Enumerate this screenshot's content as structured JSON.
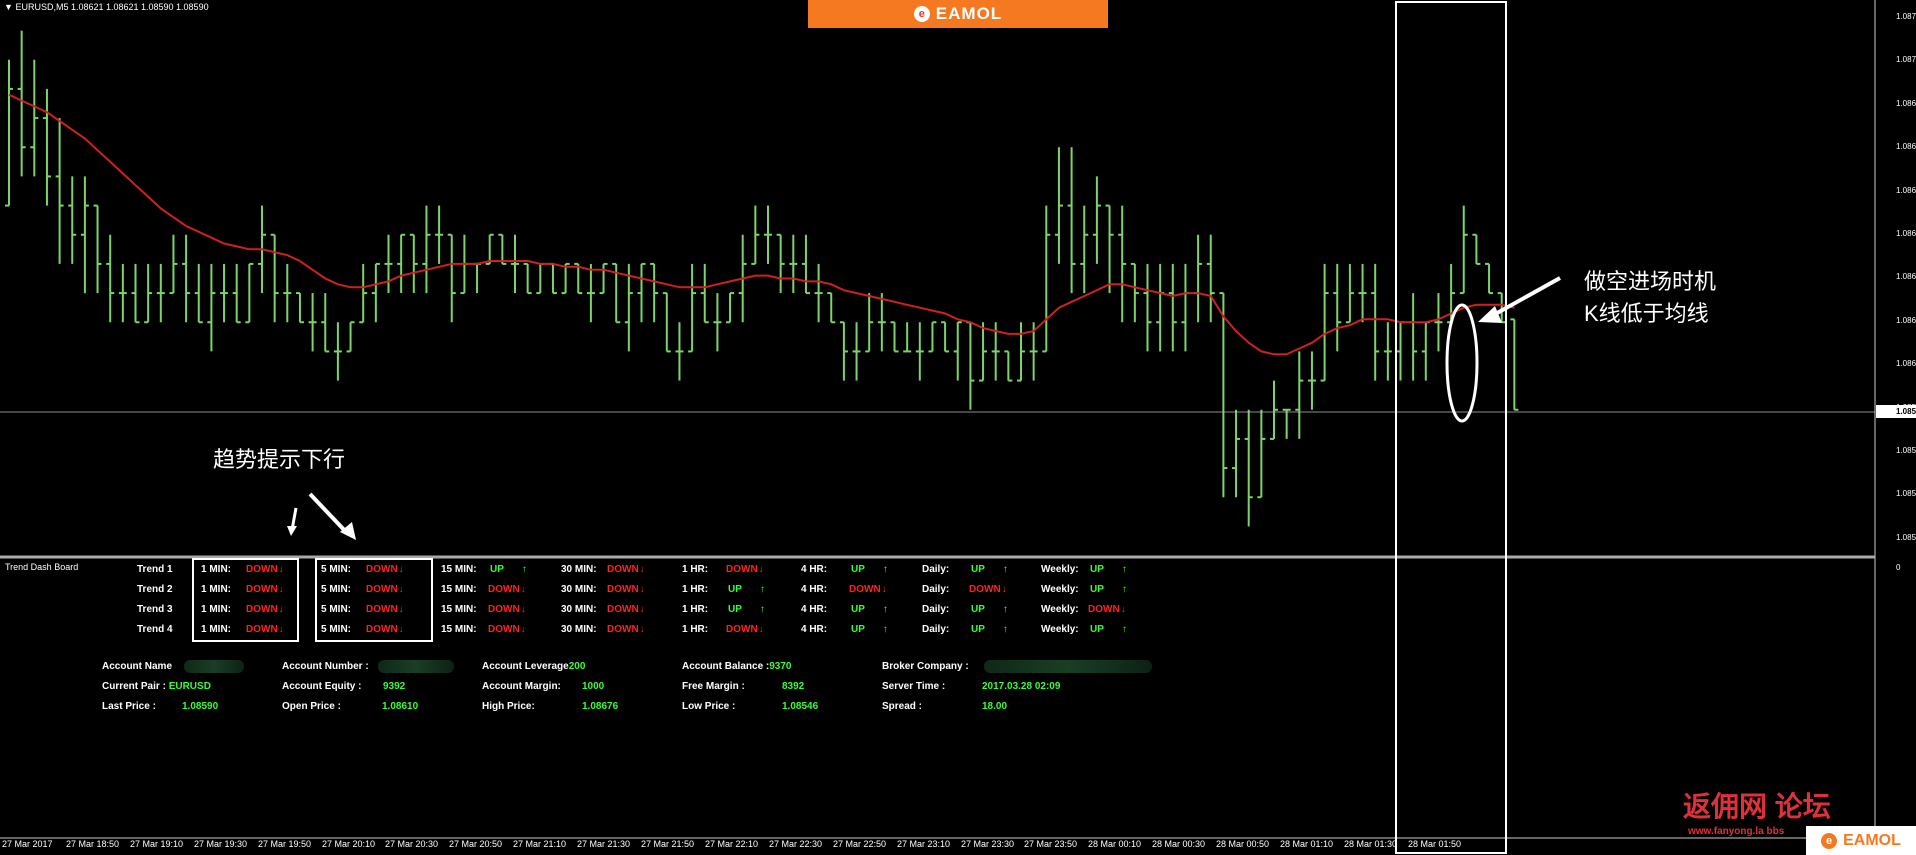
{
  "header": {
    "symbol_info": "EURUSD,M5  1.08621 1.08621 1.08590 1.08590"
  },
  "logo": {
    "text": "EAMOL"
  },
  "annotations": {
    "right_line1": "做空进场时机",
    "right_line2": "K线低于均线",
    "left": "趋势提示下行"
  },
  "colors": {
    "bar": "#7cd46a",
    "ma": "#d02020",
    "up": "#33ff33",
    "down": "#ff2020",
    "logo_bg": "#f47920"
  },
  "price_axis": [
    "1.08725",
    "1.08710",
    "1.08695",
    "1.08680",
    "1.08665",
    "1.08650",
    "1.08635",
    "1.08620",
    "1.08605",
    "1.08590",
    "1.08575",
    "1.08560",
    "1.08545"
  ],
  "current_price": "1.08590",
  "time_axis": [
    "27 Mar 2017",
    "27 Mar 18:50",
    "27 Mar 19:10",
    "27 Mar 19:30",
    "27 Mar 19:50",
    "27 Mar 20:10",
    "27 Mar 20:30",
    "27 Mar 20:50",
    "27 Mar 21:10",
    "27 Mar 21:30",
    "27 Mar 21:50",
    "27 Mar 22:10",
    "27 Mar 22:30",
    "27 Mar 22:50",
    "27 Mar 23:10",
    "27 Mar 23:30",
    "27 Mar 23:50",
    "28 Mar 00:10",
    "28 Mar 00:30",
    "28 Mar 00:50",
    "28 Mar 01:10",
    "28 Mar 01:30",
    "28 Mar 01:50"
  ],
  "panel": {
    "title": "Trend Dash Board",
    "zero_label": "0"
  },
  "trend_board": {
    "timeframes": [
      "1 MIN:",
      "5 MIN:",
      "15 MIN:",
      "30 MIN:",
      "1 HR:",
      "4 HR:",
      "Daily:",
      "Weekly:"
    ],
    "rows": [
      {
        "label": "Trend 1",
        "values": [
          "DOWN",
          "DOWN",
          "UP",
          "DOWN",
          "DOWN",
          "UP",
          "UP",
          "UP"
        ]
      },
      {
        "label": "Trend 2",
        "values": [
          "DOWN",
          "DOWN",
          "DOWN",
          "DOWN",
          "UP",
          "DOWN",
          "DOWN",
          "UP"
        ]
      },
      {
        "label": "Trend 3",
        "values": [
          "DOWN",
          "DOWN",
          "DOWN",
          "DOWN",
          "UP",
          "UP",
          "UP",
          "DOWN"
        ]
      },
      {
        "label": "Trend 4",
        "values": [
          "DOWN",
          "DOWN",
          "DOWN",
          "DOWN",
          "DOWN",
          "UP",
          "UP",
          "UP"
        ]
      }
    ]
  },
  "account": {
    "account_name_label": "Account Name",
    "account_number_label": "Account Number :",
    "account_leverage_label": "Account Leverage",
    "account_leverage": "200",
    "account_balance_label": "Account Balance :",
    "account_balance": "9370",
    "broker_company_label": "Broker Company :",
    "current_pair_label": "Current Pair :",
    "current_pair": "EURUSD",
    "account_equity_label": "Account Equity :",
    "account_equity": "9392",
    "account_margin_label": "Account Margin:",
    "account_margin": "1000",
    "free_margin_label": "Free Margin :",
    "free_margin": "8392",
    "server_time_label": "Server Time :",
    "server_time": "2017.03.28 02:09",
    "last_price_label": "Last Price :",
    "last_price": "1.08590",
    "open_price_label": "Open Price :",
    "open_price": "1.08610",
    "high_price_label": "High Price:",
    "high_price": "1.08676",
    "low_price_label": "Low Price :",
    "low_price": "1.08546",
    "spread_label": "Spread :",
    "spread": "18.00"
  },
  "watermark": {
    "forum": "返佣网 论坛",
    "url": "www.fanyong.la bbs"
  },
  "chart_data": {
    "type": "ohlc",
    "price_range": [
      1.08545,
      1.08725
    ],
    "bars": [
      [
        1.0866,
        1.0871,
        1.0866,
        1.087
      ],
      [
        1.087,
        1.0872,
        1.0867,
        1.0868
      ],
      [
        1.0868,
        1.0871,
        1.0867,
        1.0869
      ],
      [
        1.0869,
        1.087,
        1.0866,
        1.0867
      ],
      [
        1.0867,
        1.0869,
        1.0864,
        1.0866
      ],
      [
        1.0866,
        1.0867,
        1.0864,
        1.0865
      ],
      [
        1.0865,
        1.0867,
        1.0863,
        1.0866
      ],
      [
        1.0866,
        1.0866,
        1.0863,
        1.0864
      ],
      [
        1.0864,
        1.0865,
        1.0862,
        1.0863
      ],
      [
        1.0863,
        1.0864,
        1.0862,
        1.0863
      ],
      [
        1.0863,
        1.0864,
        1.0862,
        1.0862
      ],
      [
        1.0862,
        1.0864,
        1.0862,
        1.0863
      ],
      [
        1.0863,
        1.0864,
        1.0862,
        1.0863
      ],
      [
        1.0863,
        1.0865,
        1.0863,
        1.0864
      ],
      [
        1.0864,
        1.0865,
        1.0862,
        1.0863
      ],
      [
        1.0863,
        1.0864,
        1.0862,
        1.0862
      ],
      [
        1.0862,
        1.0864,
        1.0861,
        1.0863
      ],
      [
        1.0863,
        1.0864,
        1.0862,
        1.0863
      ],
      [
        1.0863,
        1.0864,
        1.0862,
        1.0862
      ],
      [
        1.0862,
        1.0864,
        1.0862,
        1.0864
      ],
      [
        1.0864,
        1.0866,
        1.0863,
        1.0865
      ],
      [
        1.0865,
        1.0865,
        1.0862,
        1.0863
      ],
      [
        1.0863,
        1.0864,
        1.0862,
        1.0863
      ],
      [
        1.0863,
        1.0863,
        1.0862,
        1.0862
      ],
      [
        1.0862,
        1.0863,
        1.0861,
        1.0862
      ],
      [
        1.0862,
        1.0863,
        1.0861,
        1.0861
      ],
      [
        1.0861,
        1.0862,
        1.086,
        1.0861
      ],
      [
        1.0861,
        1.0862,
        1.0861,
        1.0862
      ],
      [
        1.0862,
        1.0864,
        1.0862,
        1.0863
      ],
      [
        1.0863,
        1.0864,
        1.0862,
        1.0864
      ],
      [
        1.0864,
        1.0865,
        1.0863,
        1.0864
      ],
      [
        1.0864,
        1.0865,
        1.0863,
        1.0865
      ],
      [
        1.0865,
        1.0865,
        1.0863,
        1.0864
      ],
      [
        1.0864,
        1.0866,
        1.0863,
        1.0865
      ],
      [
        1.0865,
        1.0866,
        1.0864,
        1.0865
      ],
      [
        1.0865,
        1.0865,
        1.0862,
        1.0863
      ],
      [
        1.0863,
        1.0865,
        1.0863,
        1.0864
      ],
      [
        1.0864,
        1.0864,
        1.0863,
        1.0864
      ],
      [
        1.0864,
        1.0865,
        1.0864,
        1.0865
      ],
      [
        1.0865,
        1.0865,
        1.0864,
        1.0864
      ],
      [
        1.0864,
        1.0865,
        1.0863,
        1.0864
      ],
      [
        1.0864,
        1.0864,
        1.0863,
        1.0863
      ],
      [
        1.0863,
        1.0864,
        1.0863,
        1.0864
      ],
      [
        1.0864,
        1.0864,
        1.0863,
        1.0863
      ],
      [
        1.0863,
        1.0864,
        1.0863,
        1.0864
      ],
      [
        1.0864,
        1.0864,
        1.0863,
        1.0863
      ],
      [
        1.0863,
        1.0864,
        1.0862,
        1.0863
      ],
      [
        1.0863,
        1.0864,
        1.0863,
        1.0864
      ],
      [
        1.0864,
        1.0864,
        1.0862,
        1.0862
      ],
      [
        1.0862,
        1.0864,
        1.0861,
        1.0863
      ],
      [
        1.0863,
        1.0864,
        1.0862,
        1.0864
      ],
      [
        1.0864,
        1.0864,
        1.0862,
        1.0863
      ],
      [
        1.0863,
        1.0863,
        1.0861,
        1.0861
      ],
      [
        1.0861,
        1.0862,
        1.086,
        1.0861
      ],
      [
        1.0861,
        1.0864,
        1.0861,
        1.0863
      ],
      [
        1.0863,
        1.0864,
        1.0862,
        1.0862
      ],
      [
        1.0862,
        1.0863,
        1.0861,
        1.0862
      ],
      [
        1.0862,
        1.0863,
        1.0862,
        1.0863
      ],
      [
        1.0863,
        1.0865,
        1.0862,
        1.0864
      ],
      [
        1.0864,
        1.0866,
        1.0864,
        1.0865
      ],
      [
        1.0865,
        1.0866,
        1.0864,
        1.0865
      ],
      [
        1.0865,
        1.0865,
        1.0863,
        1.0864
      ],
      [
        1.0864,
        1.0865,
        1.0863,
        1.0864
      ],
      [
        1.0864,
        1.0865,
        1.0863,
        1.0863
      ],
      [
        1.0863,
        1.0864,
        1.0862,
        1.0863
      ],
      [
        1.0863,
        1.0863,
        1.0862,
        1.0862
      ],
      [
        1.0862,
        1.0862,
        1.086,
        1.0861
      ],
      [
        1.0861,
        1.0862,
        1.086,
        1.0861
      ],
      [
        1.0861,
        1.0863,
        1.0861,
        1.0862
      ],
      [
        1.0862,
        1.0863,
        1.0861,
        1.0862
      ],
      [
        1.0862,
        1.0862,
        1.0861,
        1.0861
      ],
      [
        1.0861,
        1.0862,
        1.0861,
        1.0861
      ],
      [
        1.0861,
        1.0862,
        1.086,
        1.0861
      ],
      [
        1.0861,
        1.0862,
        1.0861,
        1.0862
      ],
      [
        1.0862,
        1.0862,
        1.0861,
        1.0861
      ],
      [
        1.0861,
        1.0862,
        1.086,
        1.0862
      ],
      [
        1.0862,
        1.0862,
        1.0859,
        1.086
      ],
      [
        1.086,
        1.0862,
        1.086,
        1.0861
      ],
      [
        1.0861,
        1.0862,
        1.086,
        1.0861
      ],
      [
        1.0861,
        1.0861,
        1.086,
        1.086
      ],
      [
        1.086,
        1.0862,
        1.086,
        1.0861
      ],
      [
        1.0861,
        1.0862,
        1.086,
        1.0861
      ],
      [
        1.0861,
        1.0866,
        1.0861,
        1.0865
      ],
      [
        1.0865,
        1.0868,
        1.0864,
        1.0866
      ],
      [
        1.0866,
        1.0868,
        1.0863,
        1.0864
      ],
      [
        1.0864,
        1.0866,
        1.0863,
        1.0865
      ],
      [
        1.0865,
        1.0867,
        1.0864,
        1.0866
      ],
      [
        1.0866,
        1.0866,
        1.0863,
        1.0865
      ],
      [
        1.0865,
        1.0866,
        1.0862,
        1.0864
      ],
      [
        1.0864,
        1.0864,
        1.0862,
        1.0863
      ],
      [
        1.0863,
        1.0864,
        1.0861,
        1.0862
      ],
      [
        1.0862,
        1.0864,
        1.0861,
        1.0863
      ],
      [
        1.0863,
        1.0864,
        1.0861,
        1.0862
      ],
      [
        1.0862,
        1.0864,
        1.0861,
        1.0863
      ],
      [
        1.0863,
        1.0865,
        1.0862,
        1.0864
      ],
      [
        1.0864,
        1.0865,
        1.0862,
        1.0863
      ],
      [
        1.0863,
        1.0863,
        1.0856,
        1.0857
      ],
      [
        1.0857,
        1.0859,
        1.0856,
        1.0858
      ],
      [
        1.0858,
        1.0859,
        1.0855,
        1.0856
      ],
      [
        1.0856,
        1.0859,
        1.0856,
        1.0858
      ],
      [
        1.0858,
        1.086,
        1.0858,
        1.0859
      ],
      [
        1.0859,
        1.0859,
        1.0858,
        1.0859
      ],
      [
        1.0859,
        1.0861,
        1.0858,
        1.086
      ],
      [
        1.086,
        1.0861,
        1.0859,
        1.086
      ],
      [
        1.086,
        1.0864,
        1.086,
        1.0863
      ],
      [
        1.0863,
        1.0864,
        1.0861,
        1.0862
      ],
      [
        1.0862,
        1.0864,
        1.0862,
        1.0863
      ],
      [
        1.0863,
        1.0864,
        1.0862,
        1.0863
      ],
      [
        1.0863,
        1.0864,
        1.086,
        1.0861
      ],
      [
        1.0861,
        1.0862,
        1.086,
        1.0861
      ],
      [
        1.0861,
        1.0862,
        1.086,
        1.0862
      ],
      [
        1.0862,
        1.0863,
        1.086,
        1.0861
      ],
      [
        1.0861,
        1.0862,
        1.086,
        1.0862
      ],
      [
        1.0862,
        1.0863,
        1.0861,
        1.0862
      ],
      [
        1.0862,
        1.0864,
        1.0862,
        1.0863
      ],
      [
        1.0863,
        1.0866,
        1.0863,
        1.0865
      ],
      [
        1.0865,
        1.0865,
        1.0864,
        1.0864
      ],
      [
        1.0864,
        1.0864,
        1.0863,
        1.0863
      ],
      [
        1.0863,
        1.0863,
        1.0862,
        1.0862
      ],
      [
        1.08621,
        1.08621,
        1.0859,
        1.0859
      ]
    ],
    "ma": [
      1.08698,
      1.08696,
      1.08694,
      1.08692,
      1.08689,
      1.08686,
      1.08683,
      1.08679,
      1.08675,
      1.08671,
      1.08667,
      1.08663,
      1.08659,
      1.08656,
      1.08653,
      1.08651,
      1.08649,
      1.08647,
      1.08646,
      1.08645,
      1.08645,
      1.08644,
      1.08643,
      1.08641,
      1.08638,
      1.08635,
      1.08633,
      1.08632,
      1.08632,
      1.08633,
      1.08634,
      1.08636,
      1.08637,
      1.08638,
      1.08639,
      1.0864,
      1.0864,
      1.0864,
      1.08641,
      1.08641,
      1.08641,
      1.08641,
      1.0864,
      1.0864,
      1.08639,
      1.08639,
      1.08638,
      1.08638,
      1.08637,
      1.08636,
      1.08635,
      1.08634,
      1.08633,
      1.08632,
      1.08632,
      1.08632,
      1.08633,
      1.08634,
      1.08635,
      1.08636,
      1.08636,
      1.08635,
      1.08635,
      1.08634,
      1.08634,
      1.08633,
      1.08631,
      1.0863,
      1.08629,
      1.08628,
      1.08627,
      1.08626,
      1.08625,
      1.08624,
      1.08623,
      1.08621,
      1.0862,
      1.08618,
      1.08617,
      1.08616,
      1.08616,
      1.08617,
      1.08621,
      1.08625,
      1.08627,
      1.08629,
      1.08631,
      1.08633,
      1.08633,
      1.08632,
      1.08631,
      1.0863,
      1.08629,
      1.0863,
      1.0863,
      1.08629,
      1.08622,
      1.08617,
      1.08613,
      1.0861,
      1.08609,
      1.08609,
      1.08611,
      1.08613,
      1.08616,
      1.08618,
      1.08619,
      1.08621,
      1.08621,
      1.08621,
      1.0862,
      1.0862,
      1.0862,
      1.08621,
      1.08623,
      1.08625,
      1.08626,
      1.08626,
      1.08626,
      1.08625
    ]
  }
}
